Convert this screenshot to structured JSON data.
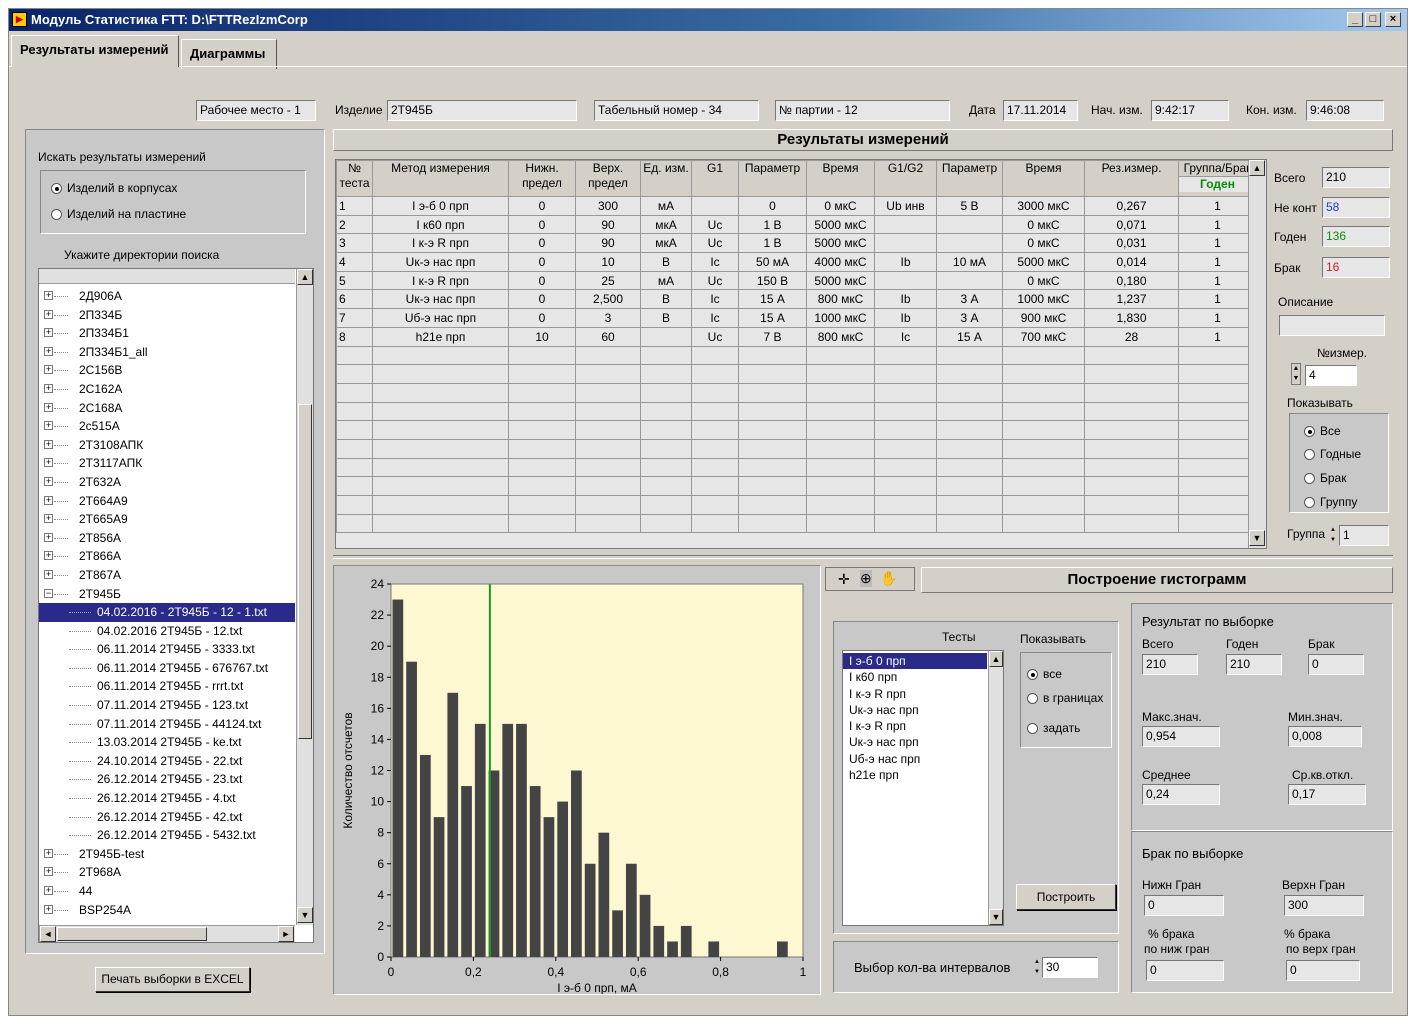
{
  "window": {
    "title": "Модуль Статистика FTT:  D:\\FTTRezIzmCorp",
    "min": "_",
    "max": "□",
    "close": "×"
  },
  "tabs": [
    "Результаты измерений",
    "Диаграммы"
  ],
  "header": {
    "workplace": "Рабочее место - 1",
    "product_label": "Изделие",
    "product": "2Т945Б",
    "tab_number": "Табельный номер - 34",
    "batch": "№ партии - 12",
    "date_label": "Дата",
    "date": "17.11.2014",
    "start_label": "Нач. изм.",
    "start": "9:42:17",
    "end_label": "Кон. изм.",
    "end": "9:46:08"
  },
  "search": {
    "title": "Искать результаты измерений",
    "opt1": "Изделий в корпусах",
    "opt2": "Изделий на пластине",
    "dir_label": "Укажите директории поиска",
    "tree": [
      {
        "t": "2Д906А",
        "lvl": 0,
        "exp": "+"
      },
      {
        "t": "2П334Б",
        "lvl": 0,
        "exp": "+"
      },
      {
        "t": "2П334Б1",
        "lvl": 0,
        "exp": "+"
      },
      {
        "t": "2П334Б1_all",
        "lvl": 0,
        "exp": "+"
      },
      {
        "t": "2С156В",
        "lvl": 0,
        "exp": "+"
      },
      {
        "t": "2С162А",
        "lvl": 0,
        "exp": "+"
      },
      {
        "t": "2С168А",
        "lvl": 0,
        "exp": "+"
      },
      {
        "t": "2с515А",
        "lvl": 0,
        "exp": "+"
      },
      {
        "t": "2Т3108АПК",
        "lvl": 0,
        "exp": "+"
      },
      {
        "t": "2Т3117АПК",
        "lvl": 0,
        "exp": "+"
      },
      {
        "t": "2Т632А",
        "lvl": 0,
        "exp": "+"
      },
      {
        "t": "2Т664А9",
        "lvl": 0,
        "exp": "+"
      },
      {
        "t": "2Т665А9",
        "lvl": 0,
        "exp": "+"
      },
      {
        "t": "2Т856А",
        "lvl": 0,
        "exp": "+"
      },
      {
        "t": "2Т866А",
        "lvl": 0,
        "exp": "+"
      },
      {
        "t": "2Т867А",
        "lvl": 0,
        "exp": "+"
      },
      {
        "t": "2Т945Б",
        "lvl": 0,
        "exp": "−"
      },
      {
        "t": "04.02.2016 - 2Т945Б - 12 - 1.txt",
        "lvl": 1,
        "sel": true
      },
      {
        "t": "04.02.2016 2Т945Б - 12.txt",
        "lvl": 1
      },
      {
        "t": "06.11.2014 2Т945Б - 3333.txt",
        "lvl": 1
      },
      {
        "t": "06.11.2014 2Т945Б - 676767.txt",
        "lvl": 1
      },
      {
        "t": "06.11.2014 2Т945Б - rrrt.txt",
        "lvl": 1
      },
      {
        "t": "07.11.2014 2Т945Б - 123.txt",
        "lvl": 1
      },
      {
        "t": "07.11.2014 2Т945Б - 44124.txt",
        "lvl": 1
      },
      {
        "t": "13.03.2014 2Т945Б - ke.txt",
        "lvl": 1
      },
      {
        "t": "24.10.2014 2Т945Б - 22.txt",
        "lvl": 1
      },
      {
        "t": "26.12.2014 2Т945Б - 23.txt",
        "lvl": 1
      },
      {
        "t": "26.12.2014 2Т945Б - 4.txt",
        "lvl": 1
      },
      {
        "t": "26.12.2014 2Т945Б - 42.txt",
        "lvl": 1
      },
      {
        "t": "26.12.2014 2Т945Б - 5432.txt",
        "lvl": 1
      },
      {
        "t": "2Т945Б-test",
        "lvl": 0,
        "exp": "+"
      },
      {
        "t": "2Т968А",
        "lvl": 0,
        "exp": "+"
      },
      {
        "t": "44",
        "lvl": 0,
        "exp": "+"
      },
      {
        "t": "BSP254A",
        "lvl": 0,
        "exp": "+"
      }
    ],
    "print_btn": "Печать выборки  в EXCEL"
  },
  "results": {
    "title": "Результаты измерений",
    "columns": [
      "№ теста",
      "Метод измерения",
      "Нижн. предел",
      "Верх. предел",
      "Ед. изм.",
      "G1",
      "Параметр",
      "Время",
      "G1/G2",
      "Параметр",
      "Время",
      "Рез.измер.",
      "Группа/Брак"
    ],
    "status": "Годен",
    "rows": [
      [
        "1",
        "I э-б 0  прп",
        "0",
        "300",
        "мА",
        "",
        "0",
        "0 мкС",
        "Ub инв",
        "5 В",
        "3000 мкС",
        "0,267",
        "1"
      ],
      [
        "2",
        "I к60  прп",
        "0",
        "90",
        "мкА",
        "Uc",
        "1 В",
        "5000 мкС",
        "",
        "",
        "0 мкС",
        "0,071",
        "1"
      ],
      [
        "3",
        "I к-э R  прп",
        "0",
        "90",
        "мкА",
        "Uc",
        "1 В",
        "5000 мкС",
        "",
        "",
        "0 мкС",
        "0,031",
        "1"
      ],
      [
        "4",
        "Uк-э нас  прп",
        "0",
        "10",
        "В",
        "Ic",
        "50 мА",
        "4000 мкС",
        "Ib",
        "10 мА",
        "5000 мкС",
        "0,014",
        "1"
      ],
      [
        "5",
        "I к-э R  прп",
        "0",
        "25",
        "мА",
        "Uc",
        "150 В",
        "5000 мкС",
        "",
        "",
        "0 мкС",
        "0,180",
        "1"
      ],
      [
        "6",
        "Uк-э нас  прп",
        "0",
        "2,500",
        "В",
        "Ic",
        "15 А",
        "800 мкС",
        "Ib",
        "3 А",
        "1000 мкС",
        "1,237",
        "1"
      ],
      [
        "7",
        "Uб-э нас  прп",
        "0",
        "3",
        "В",
        "Ic",
        "15 А",
        "1000 мкС",
        "Ib",
        "3 А",
        "900 мкС",
        "1,830",
        "1"
      ],
      [
        "8",
        "h21е  прп",
        "10",
        "60",
        "",
        "Uc",
        "7 В",
        "800 мкС",
        "Ic",
        "15 А",
        "700 мкС",
        "28",
        "1"
      ]
    ]
  },
  "summary": {
    "total_label": "Всего",
    "total": "210",
    "nokont_label": "Не конт",
    "nokont": "58",
    "good_label": "Годен",
    "good": "136",
    "bad_label": "Брак",
    "bad": "16",
    "desc_label": "Описание",
    "desc": "",
    "meas_label": "№измер.",
    "meas": "4",
    "show_label": "Показывать",
    "show_opts": [
      "Все",
      "Годные",
      "Брак",
      "Группу"
    ],
    "group_label": "Группа",
    "group": "1"
  },
  "colors": {
    "nokont": "#1e3cd0",
    "good": "#108a10",
    "bad": "#d02020",
    "status": "#0a8a0a",
    "bar": "#444444",
    "plot_bg": "#fdf7d2",
    "marker": "#1a9a1a"
  },
  "chart_data": {
    "type": "bar",
    "xlabel": "I э-б 0  прп, мА",
    "ylabel": "Количество отсчетов",
    "xlim": [
      0,
      1
    ],
    "ylim": [
      0,
      24
    ],
    "xticks": [
      "0",
      "0,2",
      "0,4",
      "0,6",
      "0,8",
      "1"
    ],
    "yticks": [
      "0",
      "2",
      "4",
      "6",
      "8",
      "10",
      "12",
      "14",
      "16",
      "18",
      "20",
      "22",
      "24"
    ],
    "bin_width": 0.0333,
    "bin_starts": [
      0,
      0.0333,
      0.0667,
      0.1,
      0.1333,
      0.1667,
      0.2,
      0.2333,
      0.2667,
      0.3,
      0.3333,
      0.3667,
      0.4,
      0.4333,
      0.4667,
      0.5,
      0.5333,
      0.5667,
      0.6,
      0.6333,
      0.6667,
      0.7,
      0.7333,
      0.7667,
      0.8,
      0.8333,
      0.8667,
      0.9,
      0.9333
    ],
    "values": [
      23,
      19,
      13,
      9,
      17,
      11,
      15,
      12,
      15,
      15,
      11,
      9,
      10,
      12,
      6,
      8,
      3,
      6,
      4,
      2,
      1,
      2,
      0,
      1,
      0,
      0,
      0,
      0,
      1
    ],
    "marker_x": 0.24
  },
  "histogram": {
    "title": "Построение гистограмм",
    "tests_label": "Тесты",
    "tests": [
      "I э-б 0  прп",
      "I к60  прп",
      "I к-э R  прп",
      "Uк-э нас  прп",
      "I к-э R  прп",
      "Uк-э нас  прп",
      "Uб-э нас  прп",
      "h21е  прп"
    ],
    "show_label": "Показывать",
    "show_opts": [
      "все",
      "в границах",
      "задать"
    ],
    "build_btn": "Построить",
    "intervals_label": "Выбор кол-ва интервалов",
    "intervals": "30"
  },
  "sample": {
    "title": "Результат по выборке",
    "total_label": "Всего",
    "total": "210",
    "good_label": "Годен",
    "good": "210",
    "bad_label": "Брак",
    "bad": "0",
    "max_label": "Макс.знач.",
    "max": "0,954",
    "min_label": "Мин.знач.",
    "min": "0,008",
    "mean_label": "Среднее",
    "mean": "0,24",
    "std_label": "Ср.кв.откл.",
    "std": "0,17",
    "reject_title": "Брак по выборке",
    "low_label": "Нижн Гран",
    "low": "0",
    "high_label": "Верхн Гран",
    "high": "300",
    "pct_low_label1": "% брака",
    "pct_low_label2": "по ниж гран",
    "pct_low": "0",
    "pct_high_label1": "% брака",
    "pct_high_label2": "по верх гран",
    "pct_high": "0"
  }
}
